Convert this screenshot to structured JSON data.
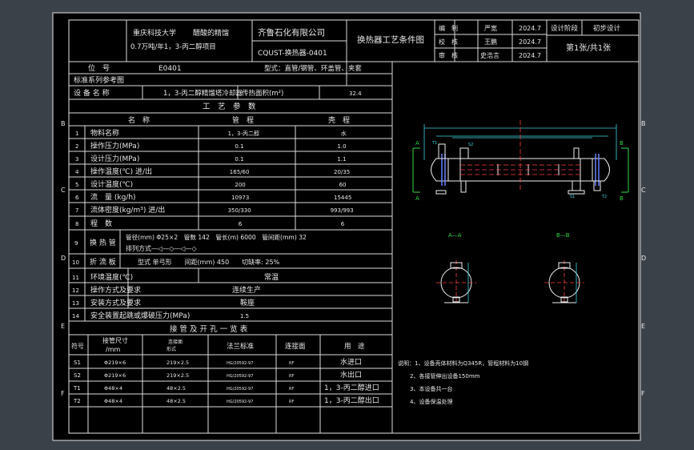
{
  "title_block": {
    "university": "重庆科技大学",
    "project_line1": "醋酸的精馏",
    "project_line2": "0.7万吨/年1，3-丙二醇项目",
    "company": "齐鲁石化有限公司",
    "drawing_no": "CQUST-换热器-0401",
    "drawing_title": "换热器工艺条件图",
    "rows": [
      {
        "role": "编　制",
        "name": "严宽",
        "date": "2024.7"
      },
      {
        "role": "校　核",
        "name": "王鹏",
        "date": "2024.7"
      },
      {
        "role": "审　核",
        "name": "史浩言",
        "date": "2024.7"
      }
    ],
    "stage_label": "设计阶段",
    "stage_value": "初步设计",
    "sheet": "第1张/共1张"
  },
  "position": {
    "label": "位　号",
    "value": "E0401",
    "type": "型式：直管/钢管、环盖管、夹套"
  },
  "std_ref": "标准系列参考图",
  "equipment": {
    "label": "设 备 名 称",
    "value": "1，3-丙二醇精馏塔冷却器",
    "area_label": "传热面积(m²)",
    "area_value": "32.4"
  },
  "params_header": "工　艺　参　数",
  "params_cols": [
    "名　称",
    "管　程",
    "壳　程"
  ],
  "params": [
    {
      "no": "1",
      "name": "物料名称",
      "tube": "1，3-丙二醇",
      "shell": "水"
    },
    {
      "no": "2",
      "name": "操作压力(MPa)",
      "tube": "0.1",
      "shell": "1.0"
    },
    {
      "no": "3",
      "name": "设计压力(MPa)",
      "tube": "0.1",
      "shell": "1.1"
    },
    {
      "no": "4",
      "name": "操作温度(℃) 进/出",
      "tube": "165/60",
      "shell": "20/35"
    },
    {
      "no": "5",
      "name": "设计温度(℃)",
      "tube": "200",
      "shell": "60"
    },
    {
      "no": "6",
      "name": "流　量 (kg/h)",
      "tube": "10973",
      "shell": "15445"
    },
    {
      "no": "7",
      "name": "流体密度(kg/m³) 进/出",
      "tube": "350/330",
      "shell": "993/993"
    },
    {
      "no": "8",
      "name": "程　数",
      "tube": "6",
      "shell": "6"
    }
  ],
  "tube_row": {
    "no": "9",
    "label": "换 热 管",
    "spec": "管径(mm) Φ25×2　管数 142　管长(m) 6000　管间距(mm) 32",
    "layout": "排列方式—◁—◇—◁—◇"
  },
  "baffle_row": {
    "no": "10",
    "label": "折 流 板",
    "spec": "型式 单弓形　　间距(mm) 450　　切缺率: 25%"
  },
  "extra_rows": [
    {
      "no": "11",
      "label": "环境温度(℃)",
      "value": "常温"
    },
    {
      "no": "12",
      "label": "操作方式及要求",
      "value": "连续生产"
    },
    {
      "no": "13",
      "label": "安装方式及要求",
      "value": "鞍座"
    },
    {
      "no": "14",
      "label": "安全装置起跳或爆破压力(MPa)",
      "value": "1.5"
    }
  ],
  "nozzle_header": "接 管 及 开 孔 一 览 表",
  "nozzle_cols": [
    "符号",
    "接管尺寸\n/mm",
    "连接面\n形式",
    "法兰标准",
    "连接面",
    "用　途"
  ],
  "nozzles": [
    {
      "sym": "S1",
      "size": "Φ219×6",
      "face": "219×2.5",
      "std": "HG/20592-97",
      "conn": "RF",
      "use": "水进口"
    },
    {
      "sym": "S2",
      "size": "Φ219×6",
      "face": "219×2.5",
      "std": "HG/20592-97",
      "conn": "RF",
      "use": "水出口"
    },
    {
      "sym": "T1",
      "size": "Φ48×4",
      "face": "48×2.5",
      "std": "HG/20592-97",
      "conn": "RF",
      "use": "1，3-丙二醇进口"
    },
    {
      "sym": "T2",
      "size": "Φ48×4",
      "face": "48×2.5",
      "std": "HG/20592-97",
      "conn": "RF",
      "use": "1，3-丙二醇出口"
    }
  ],
  "notes": [
    "说明：1、设备壳体材料为Q345R，管程材料为10钢",
    "2、各接管伸出设备150mm",
    "3、本设备共一台",
    "4、设备保温处理"
  ],
  "drawing": {
    "section_a": "A—A",
    "section_b": "B—B",
    "view_a": "A",
    "view_b": "B",
    "labels": [
      "T1",
      "S2",
      "S1",
      "T2"
    ]
  },
  "border_letters": [
    "B",
    "C",
    "D",
    "E",
    "F",
    "G"
  ]
}
